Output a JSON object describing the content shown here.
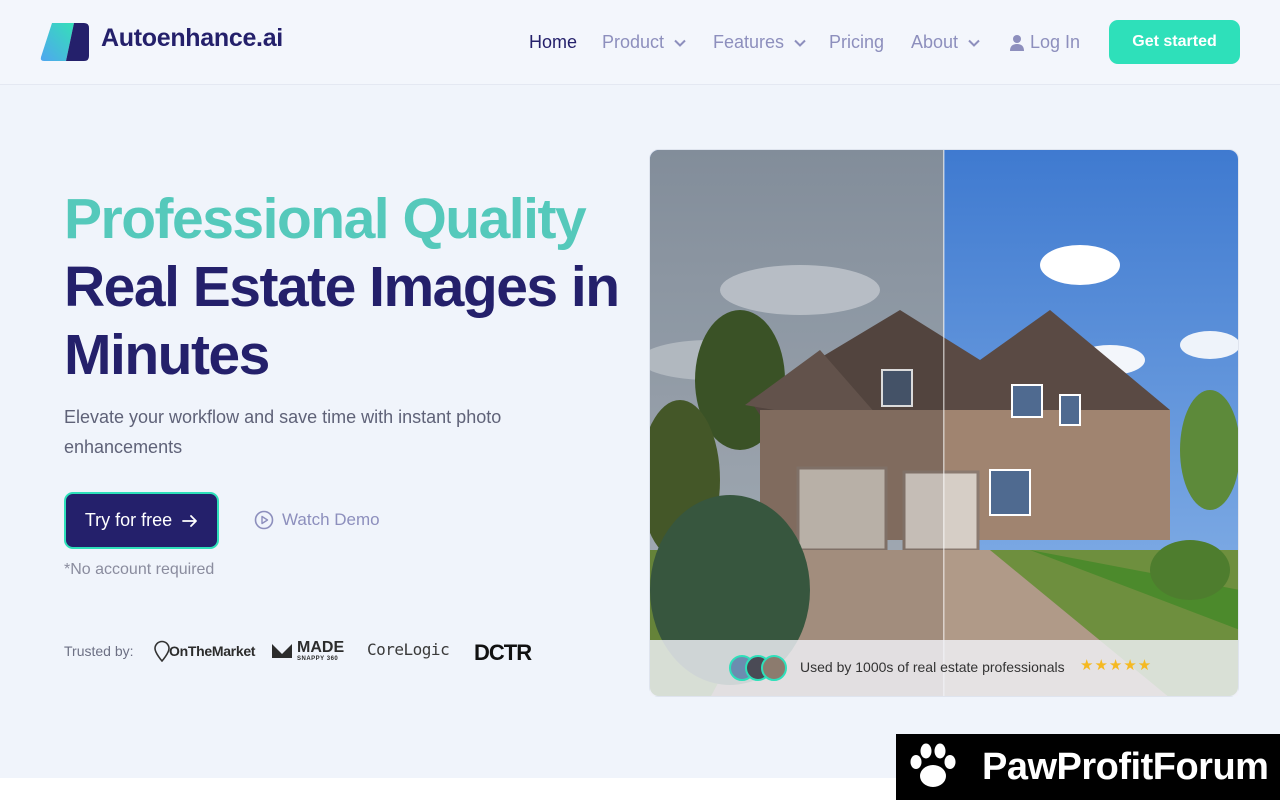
{
  "header": {
    "brand": "Autoenhance.ai",
    "nav": [
      {
        "label": "Home",
        "dropdown": false
      },
      {
        "label": "Product",
        "dropdown": true
      },
      {
        "label": "Features",
        "dropdown": true
      },
      {
        "label": "Pricing",
        "dropdown": false
      },
      {
        "label": "About",
        "dropdown": true
      },
      {
        "label": "Log In",
        "icon": "user-icon"
      }
    ],
    "cta": "Get started"
  },
  "hero": {
    "headline_1": "Professional Quality",
    "headline_2": "Real Estate Images in",
    "headline_3": "Minutes",
    "subtitle": "Elevate your workflow and save time with instant photo enhancements",
    "primary_button": "Try for free",
    "secondary_button": "Watch Demo",
    "note": "*No account required",
    "trusted_label": "Trusted by:",
    "trusted_logos": {
      "onthemarket": "OnTheMarket",
      "made": "MADE",
      "made_sub": "SNAPPY 360",
      "corelogic": "CoreLogic",
      "dctr": "DCTR"
    }
  },
  "image_panel": {
    "caption": "Used by 1000s of real estate professionals",
    "stars": "★★★★★",
    "rating": 5
  },
  "watermark": {
    "text": "PawProfitForum"
  },
  "colors": {
    "navy": "#24206b",
    "teal": "#2ee0ba",
    "teal_headline": "#55c9bb",
    "muted_nav": "#8d8fbd",
    "background": "#f0f4fb"
  }
}
